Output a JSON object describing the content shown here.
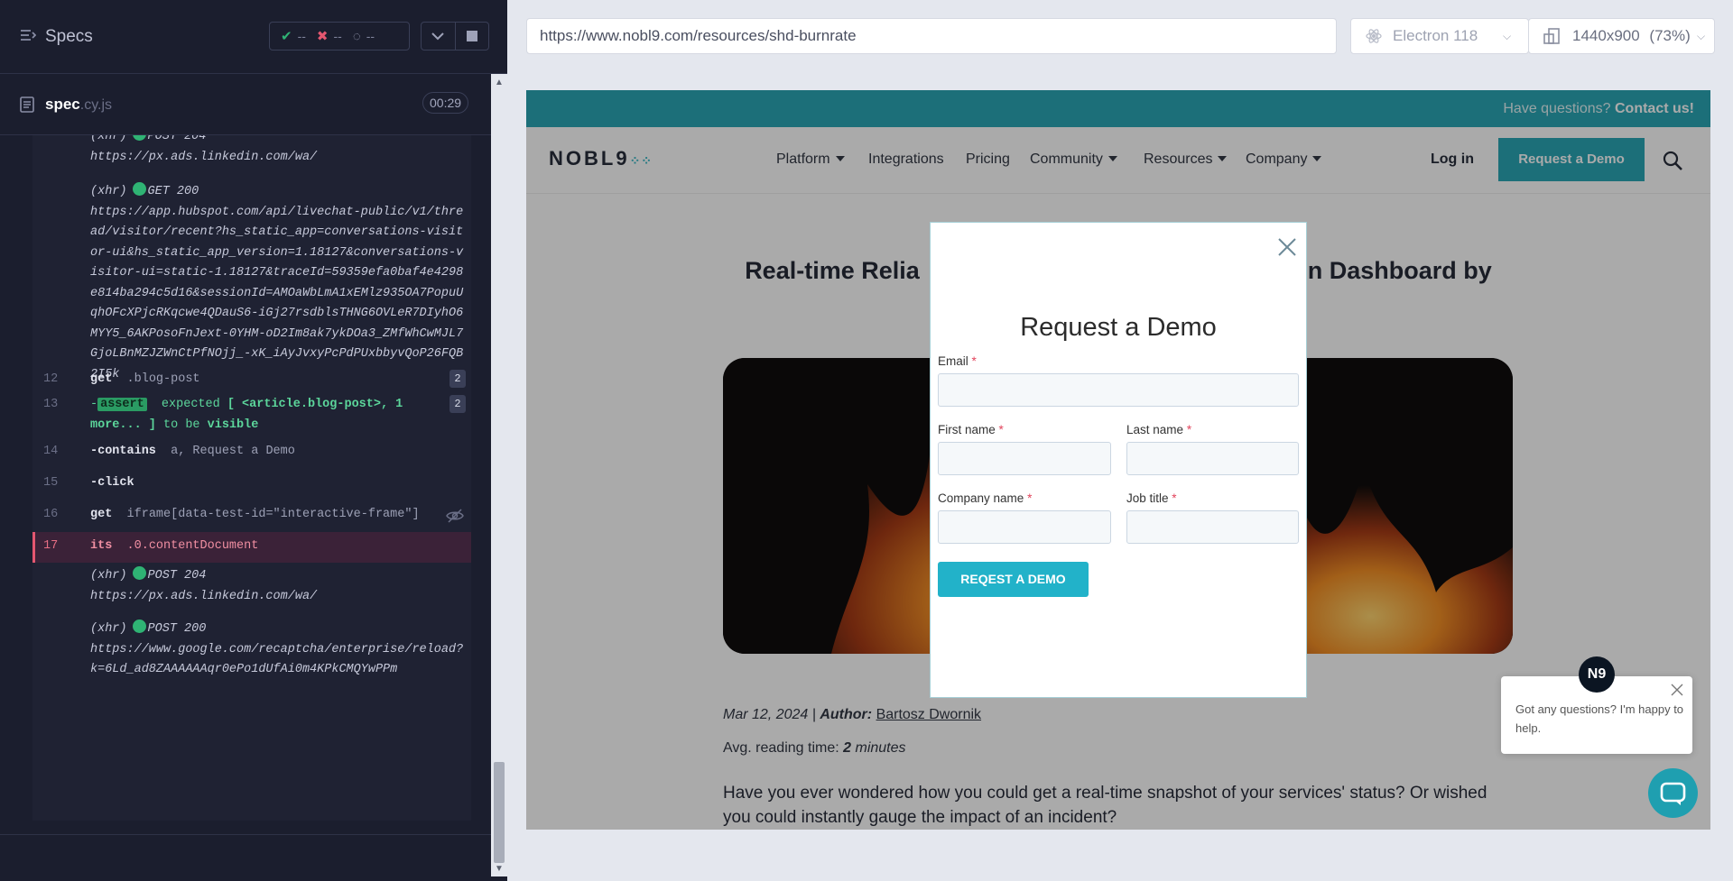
{
  "reporter": {
    "title": "Specs",
    "stats": {
      "passed": "--",
      "failed": "--",
      "pending": "--"
    },
    "spec": {
      "name": "spec",
      "ext": ".cy.js",
      "duration": "00:29"
    },
    "log": [
      {
        "kind": "xhr",
        "method": "POST 204",
        "url": "https://px.ads.linkedin.com/wa/"
      },
      {
        "kind": "xhr",
        "method": "GET 200",
        "url": "https://app.hubspot.com/api/livechat-public/v1/thread/visitor/recent?hs_static_app=conversations-visitor-ui&hs_static_app_version=1.18127&conversations-visitor-ui=static-1.18127&traceId=59359efa0baf4e4298e814ba294c5d16&sessionId=AMOaWbLmA1xEMlz935OA7PopuUqhOFcXPjcRKqcwe4QDauS6-iGj27rsdblsTHNG6OVLeR7DIyhO6MYY5_6AKPosoFnJext-0YHM-oD2Im8ak7ykDOa3_ZMfWhCwMJL7GjoLBnMZJZWnCtPfNOjj_-xK_iAyJvxyPcPdPUxbbyvQoP26FQB2I5k"
      },
      {
        "kind": "cmd",
        "num": "12",
        "name": "get",
        "arg": ".blog-post",
        "badge": "2"
      },
      {
        "kind": "assert",
        "num": "13",
        "prefix": "-",
        "tag": "assert",
        "t1": "expected",
        "t2": "[ <article.blog-post>, 1 more... ]",
        "t3": "to be",
        "t4": "visible",
        "badge": "2"
      },
      {
        "kind": "cmd",
        "num": "14",
        "name": "-contains",
        "arg": "a, Request a Demo"
      },
      {
        "kind": "cmd",
        "num": "15",
        "name": "-click",
        "arg": ""
      },
      {
        "kind": "cmd",
        "num": "16",
        "name": "get",
        "arg": "iframe[data-test-id=\"interactive-frame\"]"
      },
      {
        "kind": "cmd",
        "num": "17",
        "name": "its",
        "arg": ".0.contentDocument"
      },
      {
        "kind": "xhr",
        "method": "POST 204",
        "url": "https://px.ads.linkedin.com/wa/"
      },
      {
        "kind": "xhr",
        "method": "POST 200",
        "url": "https://www.google.com/recaptcha/enterprise/reload?k=6Ld_ad8ZAAAAAAqr0ePo1dUfAi0m4KPkCMQYwPPm"
      }
    ],
    "xhr_label": "(xhr)"
  },
  "browser": {
    "url": "https://www.nobl9.com/resources/shd-burnrate",
    "name": "Electron 118",
    "viewport": "1440x900",
    "zoom": "(73%)"
  },
  "site": {
    "topbar": {
      "question": "Have questions?",
      "contact": "Contact us!"
    },
    "logo": "NOBL9",
    "nav": [
      "Platform",
      "Integrations",
      "Pricing",
      "Community",
      "Resources",
      "Company"
    ],
    "login": "Log in",
    "cta": "Request a Demo",
    "title_left": "Real-time Relia",
    "title_right": "n Dashboard by",
    "date": "Mar 12, 2024 |",
    "author_label": "Author:",
    "author": "Bartosz Dwornik",
    "reading_label": "Avg. reading time:",
    "reading_value": "2",
    "reading_unit": "minutes",
    "intro": "Have you ever wondered how you could get a real-time snapshot of your services' status? Or wished you could instantly gauge the impact of an incident?"
  },
  "modal": {
    "title": "Request a Demo",
    "fields": {
      "email": "Email",
      "first_name": "First name",
      "last_name": "Last name",
      "company": "Company name",
      "job_title": "Job title"
    },
    "required_mark": "*",
    "submit": "REQEST A DEMO"
  },
  "chat": {
    "avatar": "N9",
    "message": "Got any questions? I'm happy to help."
  },
  "colors": {
    "accent": "#22a3b3",
    "pass": "#2fb374",
    "fail": "#e45770",
    "panel": "#1b1e2e"
  }
}
